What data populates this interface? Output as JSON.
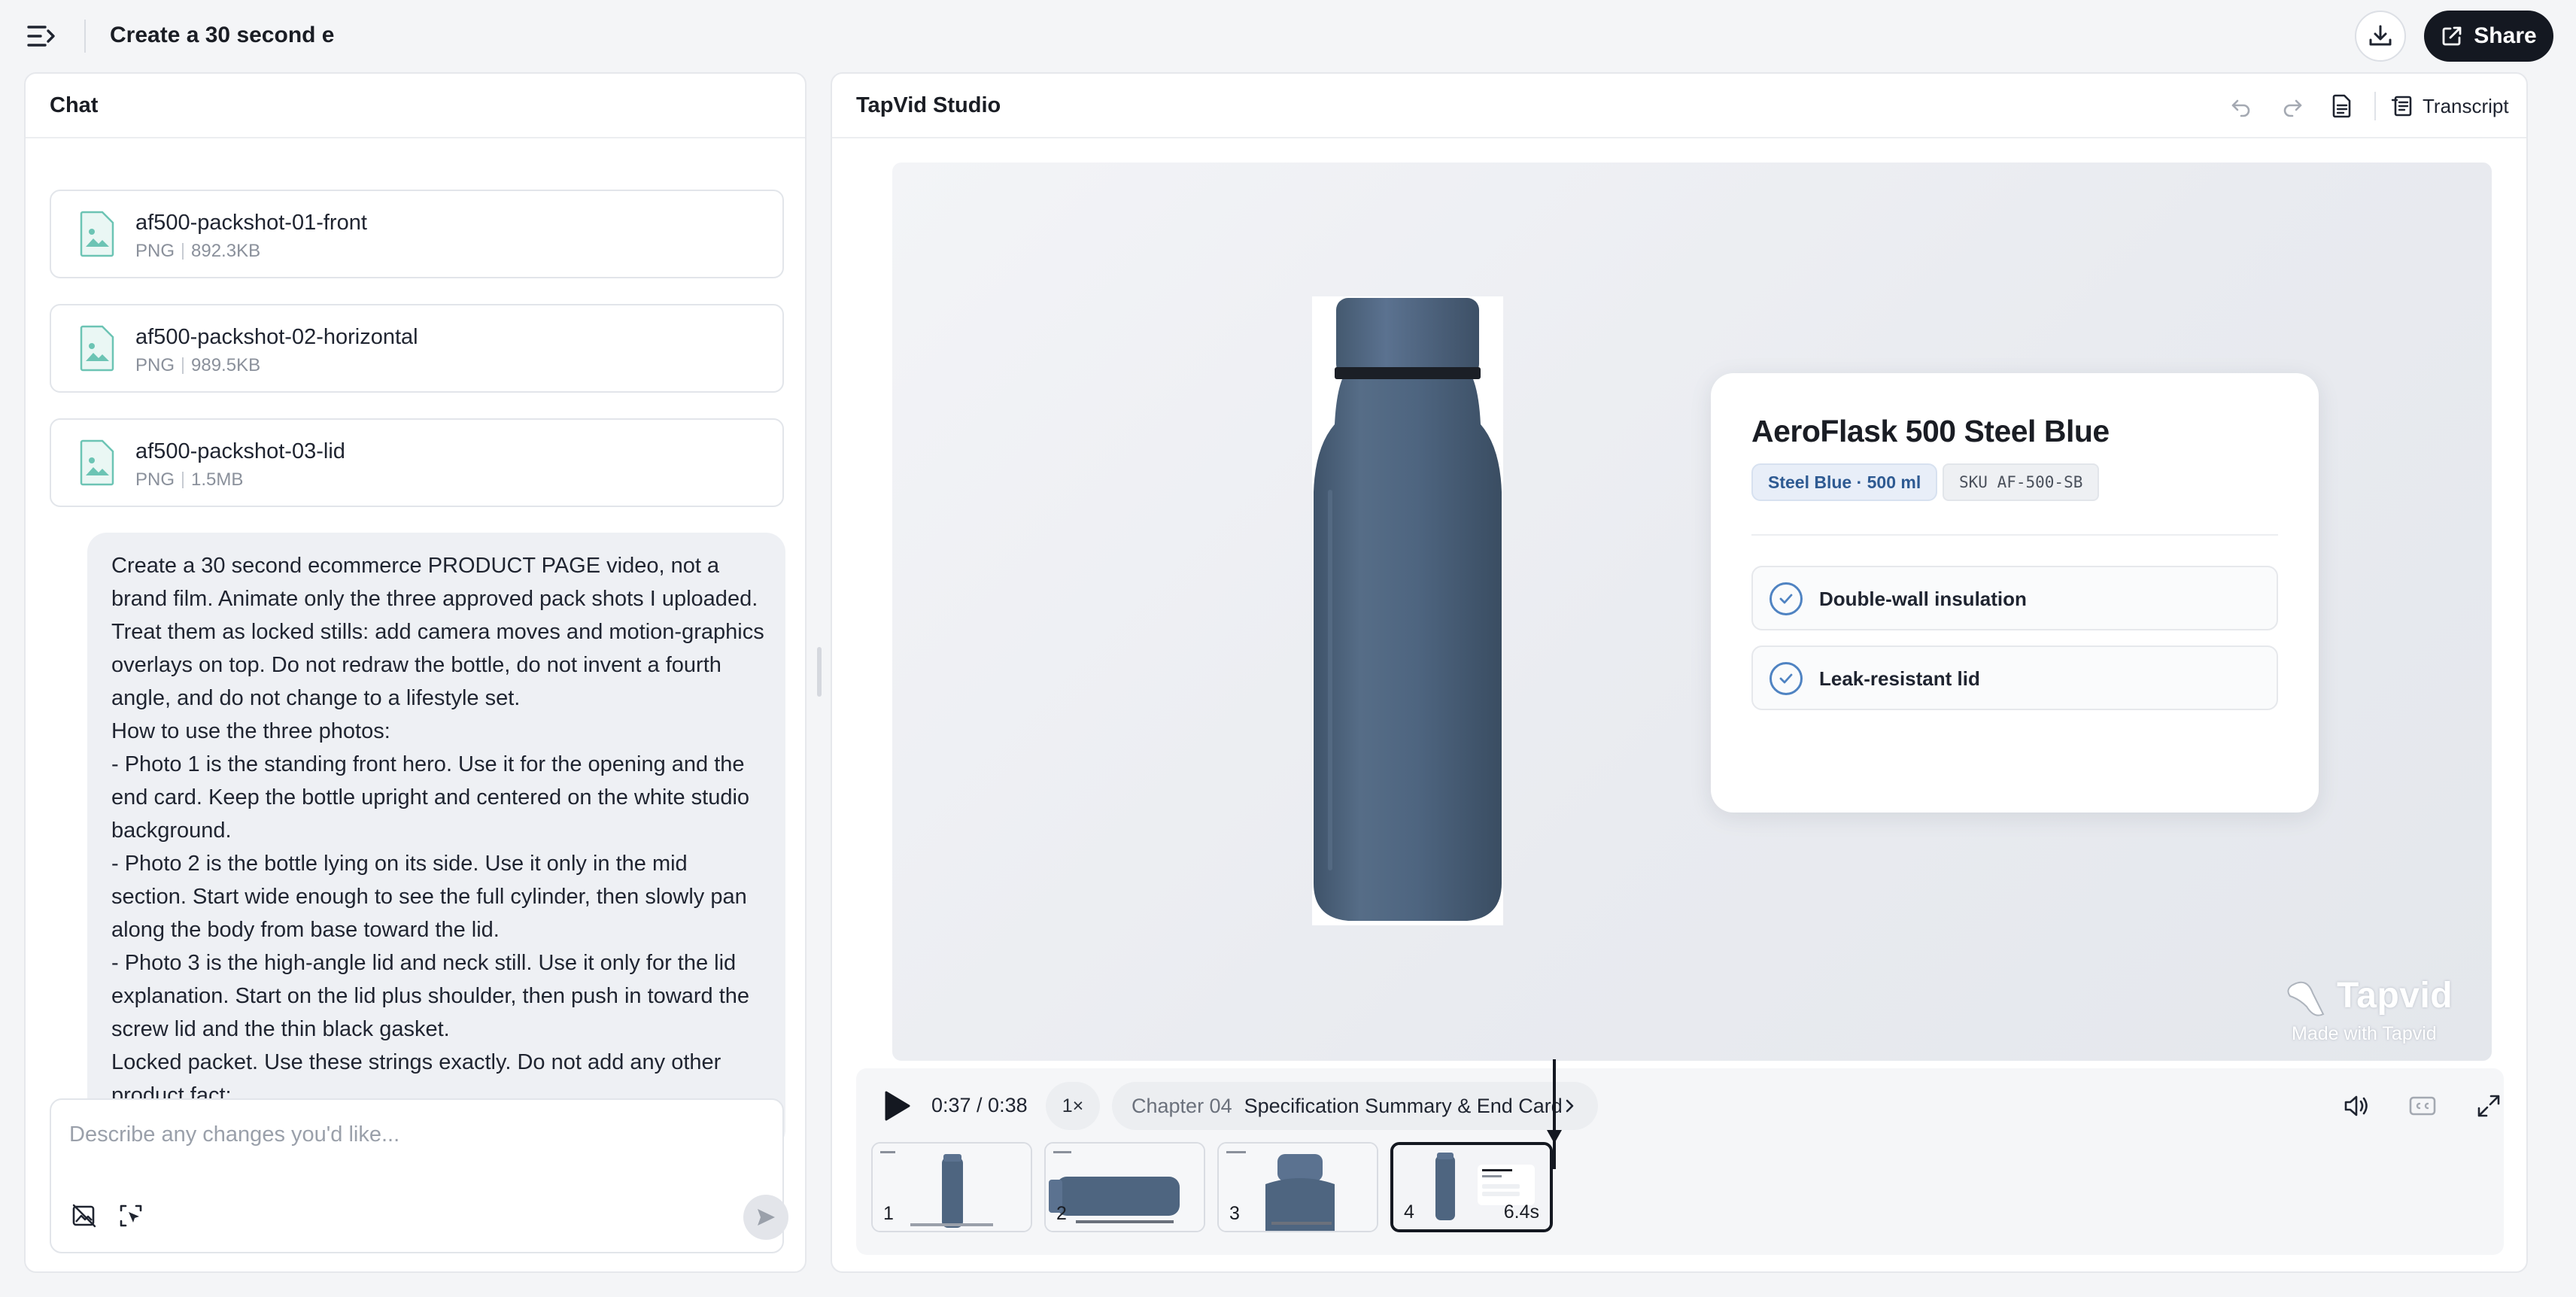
{
  "topbar": {
    "doc_title": "Create a 30 second e",
    "share_label": "Share"
  },
  "chat": {
    "title": "Chat",
    "files": [
      {
        "name": "af500-packshot-01-front",
        "type": "PNG",
        "size": "892.3KB"
      },
      {
        "name": "af500-packshot-02-horizontal",
        "type": "PNG",
        "size": "989.5KB"
      },
      {
        "name": "af500-packshot-03-lid",
        "type": "PNG",
        "size": "1.5MB"
      }
    ],
    "message": "Create a 30 second ecommerce PRODUCT PAGE video, not a brand film. Animate only the three approved pack shots I uploaded. Treat them as locked stills: add camera moves and motion-graphics overlays on top. Do not redraw the bottle, do not invent a fourth angle, and do not change to a lifestyle set.\nHow to use the three photos:\n- Photo 1 is the standing front hero. Use it for the opening and the end card. Keep the bottle upright and centered on the white studio background.\n- Photo 2 is the bottle lying on its side. Use it only in the mid section. Start wide enough to see the full cylinder, then slowly pan along the body from base toward the lid.\n- Photo 3 is the high-angle lid and neck still. Use it only for the lid explanation. Start on the lid plus shoulder, then push in toward the screw lid and the thin black gasket.\nLocked packet. Use these strings exactly. Do not add any other product fact:",
    "input_placeholder": "Describe any changes you'd like..."
  },
  "studio": {
    "title": "TapVid Studio",
    "transcript_label": "Transcript",
    "card": {
      "product_name": "AeroFlask 500 Steel Blue",
      "variant": "Steel Blue · 500 ml",
      "sku": "SKU AF-500-SB",
      "features": [
        "Double-wall insulation",
        "Leak-resistant lid"
      ]
    },
    "watermark": {
      "brand": "Tapvid",
      "sub": "Made with Tapvid"
    }
  },
  "player": {
    "time": "0:37 / 0:38",
    "speed": "1×",
    "chapter_num": "Chapter 04",
    "chapter_name": "Specification Summary & End Card",
    "thumbs": [
      {
        "num": "1",
        "duration": ""
      },
      {
        "num": "2",
        "duration": ""
      },
      {
        "num": "3",
        "duration": ""
      },
      {
        "num": "4",
        "duration": "6.4s"
      }
    ]
  },
  "colors": {
    "accent_dark": "#141821",
    "bottle_blue": "#4e6580",
    "check_blue": "#4f83c2",
    "file_icon_teal": "#6cc4b4"
  }
}
